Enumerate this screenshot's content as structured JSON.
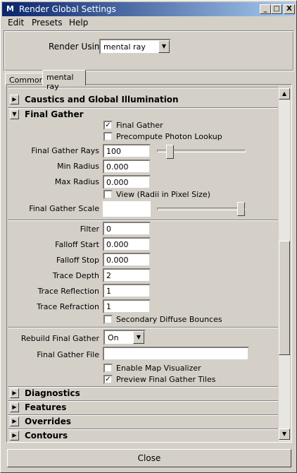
{
  "window": {
    "title": "Render Global Settings",
    "minimize": "_",
    "maximize": "□",
    "close": "X"
  },
  "menu": {
    "items": [
      "Edit",
      "Presets",
      "Help"
    ]
  },
  "render_using": {
    "label": "Render Using",
    "value": "mental ray"
  },
  "tabs": [
    "Common",
    "mental ray"
  ],
  "sections": {
    "caustics": "Caustics and Global Illumination",
    "final_gather": "Final Gather",
    "diagnostics": "Diagnostics",
    "features": "Features",
    "overrides": "Overrides",
    "contours": "Contours"
  },
  "final_gather": {
    "final_gather_label": "Final Gather",
    "precompute_label": "Precompute Photon Lookup",
    "rays_label": "Final Gather Rays",
    "rays_value": "100",
    "min_radius_label": "Min Radius",
    "min_radius_value": "0.000",
    "max_radius_label": "Max Radius",
    "max_radius_value": "0.000",
    "view_label": "View (Radii in Pixel Size)",
    "scale_label": "Final Gather Scale",
    "filter_label": "Filter",
    "filter_value": "0",
    "falloff_start_label": "Falloff Start",
    "falloff_start_value": "0.000",
    "falloff_stop_label": "Falloff Stop",
    "falloff_stop_value": "0.000",
    "trace_depth_label": "Trace Depth",
    "trace_depth_value": "2",
    "trace_reflection_label": "Trace Reflection",
    "trace_reflection_value": "1",
    "trace_refraction_label": "Trace Refraction",
    "trace_refraction_value": "1",
    "secondary_label": "Secondary Diffuse Bounces",
    "rebuild_label": "Rebuild Final Gather",
    "rebuild_value": "On",
    "file_label": "Final Gather File",
    "file_value": "",
    "enable_map_label": "Enable Map Visualizer",
    "preview_label": "Preview Final Gather Tiles"
  },
  "close_label": "Close"
}
